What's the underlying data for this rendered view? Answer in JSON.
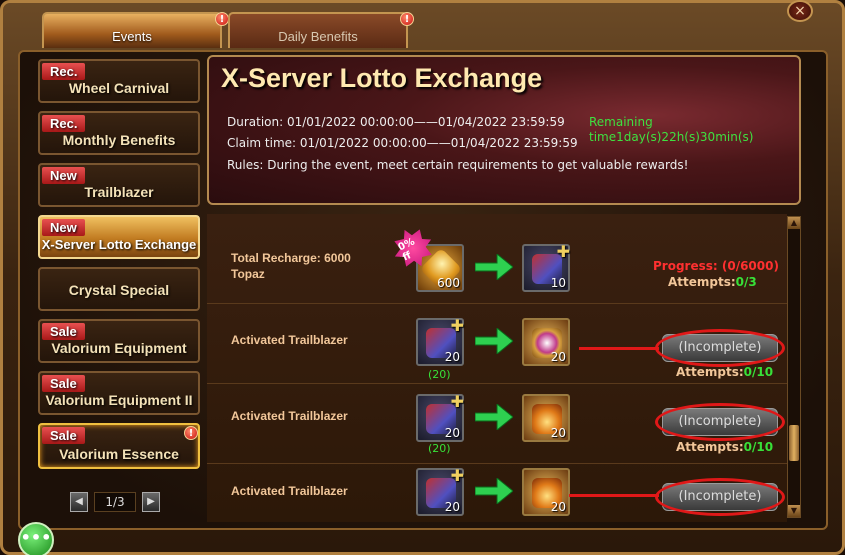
{
  "tabs": [
    {
      "label": "Events",
      "alert": "!"
    },
    {
      "label": "Daily Benefits",
      "alert": "!"
    }
  ],
  "close_icon": "×",
  "sidebar": {
    "items": [
      {
        "tag": "Rec.",
        "label": "Wheel Carnival"
      },
      {
        "tag": "Rec.",
        "label": "Monthly Benefits"
      },
      {
        "tag": "New",
        "label": "Trailblazer"
      },
      {
        "tag": "New",
        "label": "X-Server Lotto Exchange",
        "active": true
      },
      {
        "tag": "",
        "label": "Crystal Special"
      },
      {
        "tag": "Sale",
        "label": "Valorium Equipment"
      },
      {
        "tag": "Sale",
        "label": "Valorium Equipment II"
      },
      {
        "tag": "Sale",
        "label": "Valorium Essence",
        "alert": "!"
      }
    ],
    "pager": {
      "text": "1/3",
      "prev_icon": "◀",
      "next_icon": "▶"
    }
  },
  "banner": {
    "title": "X-Server Lotto Exchange",
    "duration": "Duration: 01/01/2022 00:00:00——01/04/2022 23:59:59",
    "claim": "Claim time: 01/01/2022 00:00:00——01/04/2022 23:59:59",
    "rules": "Rules: During the event, meet certain requirements to get valuable rewards!",
    "remaining_label": "Remaining",
    "remaining_value": "time1day(s)22h(s)30min(s)"
  },
  "rows": [
    {
      "label_line1": "Total Recharge: 6000",
      "label_line2": "Topaz",
      "badge": "70% off",
      "cost_qty": "600",
      "reward_qty": "10",
      "progress": "Progress: (0/6000)",
      "attempts_label": "Attempts:",
      "attempts_value": "0/3"
    },
    {
      "label_line1": "Activated Trailblazer",
      "cost_qty": "20",
      "cost_sub": "(20)",
      "reward_qty": "20",
      "button": "(Incomplete)",
      "attempts_label": "Attempts:",
      "attempts_value": "0/10"
    },
    {
      "label_line1": "Activated Trailblazer",
      "cost_qty": "20",
      "cost_sub": "(20)",
      "reward_qty": "20",
      "button": "(Incomplete)",
      "attempts_label": "Attempts:",
      "attempts_value": "0/10"
    },
    {
      "label_line1": "Activated Trailblazer",
      "cost_qty": "20",
      "reward_qty": "20",
      "button": "(Incomplete)"
    }
  ],
  "scroll": {
    "up_icon": "▲",
    "down_icon": "▼"
  },
  "chat_icon": "•••"
}
